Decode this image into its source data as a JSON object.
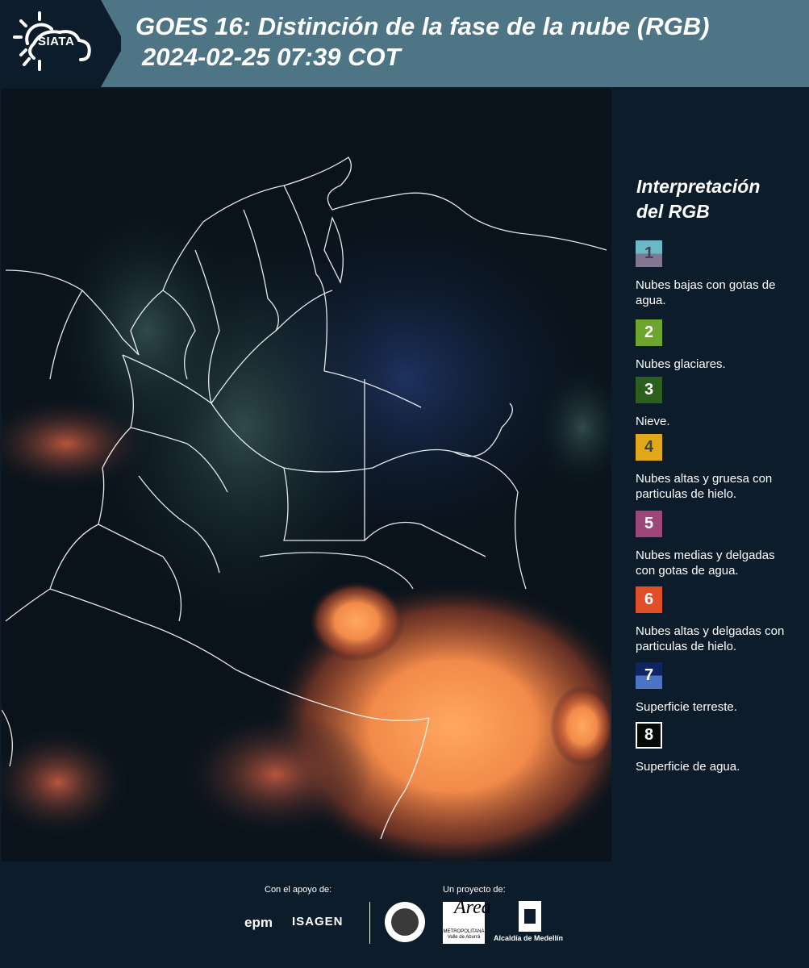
{
  "header": {
    "logo_text": "SIATA",
    "title_line1": "GOES 16: Distinción de la fase de la nube (RGB)",
    "title_line2": "2024-02-25 07:39 COT"
  },
  "legend": {
    "title_line1": "Interpretación",
    "title_line2": "del RGB",
    "items": [
      {
        "number": "1",
        "text": "Nubes bajas con gotas de agua.",
        "color_top": "#6cb9c6",
        "color_bottom": "#817792"
      },
      {
        "number": "2",
        "text": "Nubes glaciares.",
        "color": "#6ea52e"
      },
      {
        "number": "3",
        "text": "Nieve.",
        "color": "#2c5e1d"
      },
      {
        "number": "4",
        "text": "Nubes altas y gruesa con particulas de hielo.",
        "color": "#e1a81b"
      },
      {
        "number": "5",
        "text": "Nubes medias y delgadas con gotas de agua.",
        "color": "#9d4778"
      },
      {
        "number": "6",
        "text": "Nubes altas y delgadas con particulas de hielo.",
        "color": "#e14f29"
      },
      {
        "number": "7",
        "text": "Superficie terreste.",
        "color_top": "#0e2463",
        "color_bottom": "#4d74c4"
      },
      {
        "number": "8",
        "text": "Superficie de agua.",
        "color": "#050b09"
      }
    ]
  },
  "footer": {
    "support_label": "Con el apoyo de:",
    "project_label": "Un proyecto de:",
    "sponsor1": "epm",
    "sponsor2": "ISAGEN",
    "area_logo_text": "METROPOLITANA Valle de Aburrá",
    "alcaldia_text": "Alcaldía de Medellín"
  },
  "map": {
    "region": "Colombia",
    "icons": [
      "siata-logo",
      "sun-cloud-icon"
    ]
  }
}
